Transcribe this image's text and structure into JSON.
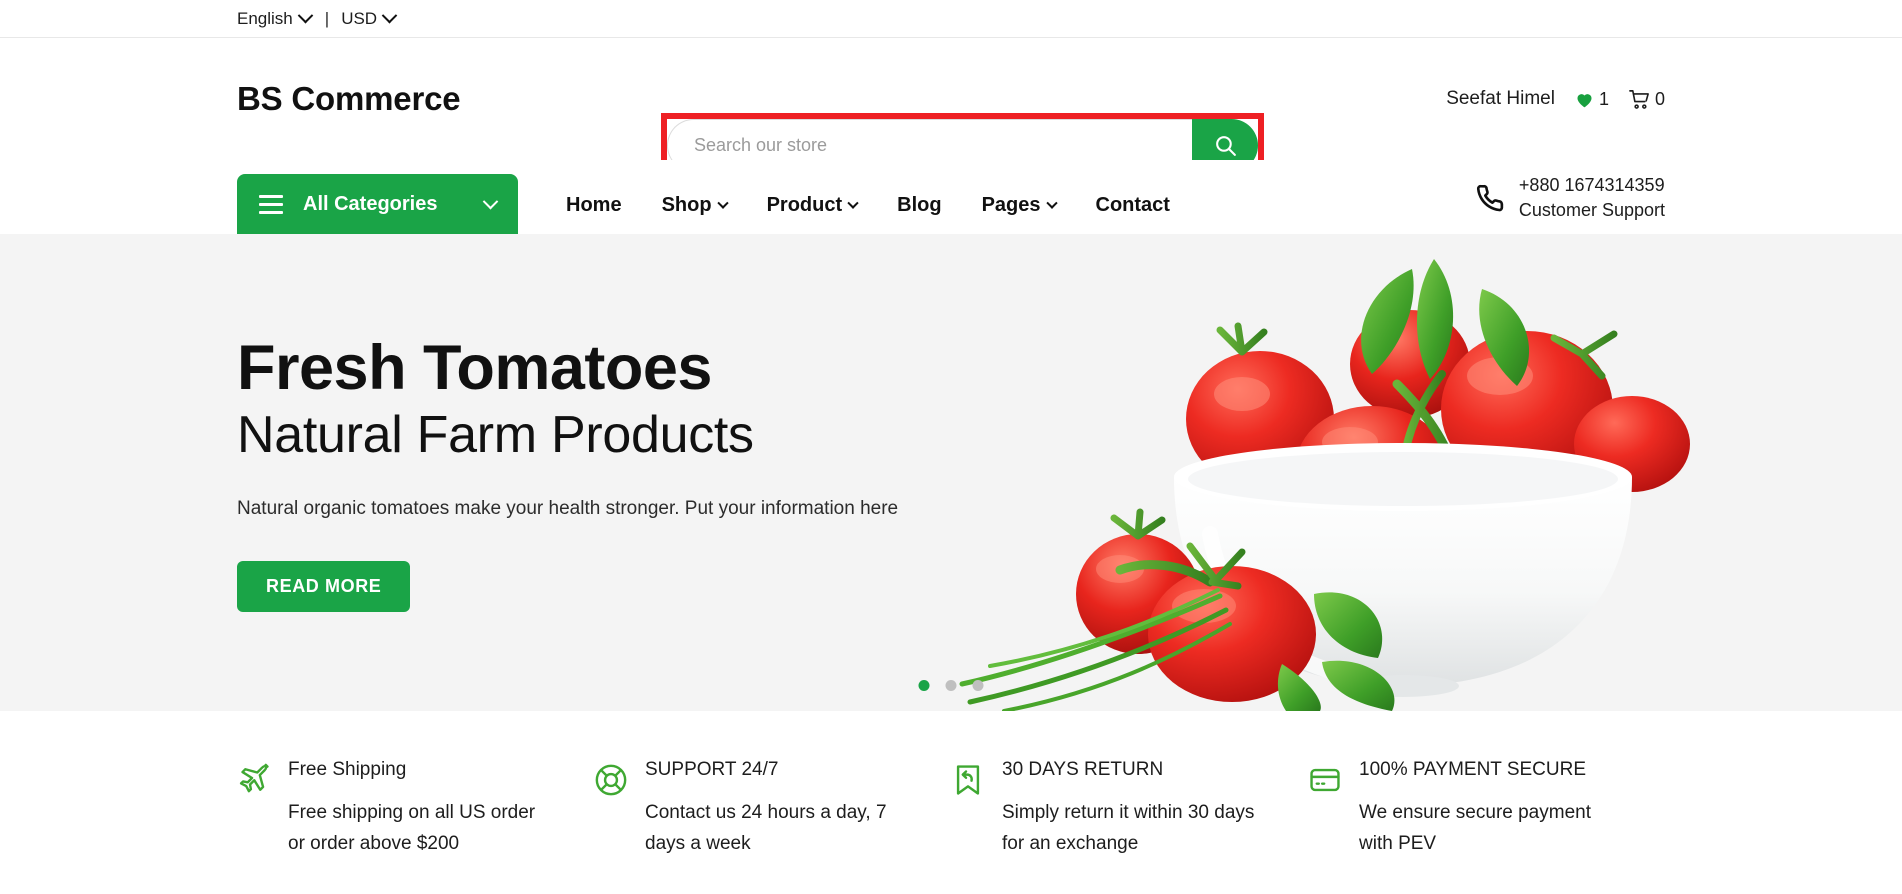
{
  "topbar": {
    "language": "English",
    "separator": "|",
    "currency": "USD"
  },
  "header": {
    "brand": "BS Commerce",
    "search": {
      "placeholder": "Search our store",
      "value": "",
      "icon": "search-icon",
      "highlight_color": "#ee2024"
    },
    "account": {
      "user_name": "Seefat Himel",
      "wishlist_icon": "heart-icon",
      "wishlist_count": "1",
      "cart_icon": "cart-icon",
      "cart_count": "0"
    }
  },
  "nav": {
    "all_categories": {
      "label": "All Categories",
      "menu_icon": "hamburger-icon",
      "chevron_icon": "chevron-down-icon"
    },
    "items": [
      {
        "label": "Home",
        "has_dropdown": false
      },
      {
        "label": "Shop",
        "has_dropdown": true
      },
      {
        "label": "Product",
        "has_dropdown": true
      },
      {
        "label": "Blog",
        "has_dropdown": false
      },
      {
        "label": "Pages",
        "has_dropdown": true
      },
      {
        "label": "Contact",
        "has_dropdown": false
      }
    ],
    "support": {
      "icon": "phone-icon",
      "phone": "+880 1674314359",
      "label": "Customer Support"
    }
  },
  "hero": {
    "title": "Fresh Tomatoes",
    "subtitle": "Natural Farm Products",
    "description": "Natural organic tomatoes make your health stronger. Put your information here",
    "button_label": "READ MORE",
    "image_alt": "bowl-of-tomatoes-image",
    "carousel": {
      "total": 3,
      "active_index": 0
    },
    "background_color": "#f4f4f4"
  },
  "features": [
    {
      "icon": "airplane-icon",
      "title": "Free Shipping",
      "description": "Free shipping on all US order or order above $200"
    },
    {
      "icon": "lifebuoy-icon",
      "title": "SUPPORT 24/7",
      "description": "Contact us 24 hours a day, 7 days a week"
    },
    {
      "icon": "return-arrow-icon",
      "title": "30 DAYS RETURN",
      "description": "Simply return it within 30 days for an exchange"
    },
    {
      "icon": "credit-card-icon",
      "title": "100% PAYMENT SECURE",
      "description": "We ensure secure payment with PEV"
    }
  ],
  "theme": {
    "accent_green": "#1aa447",
    "highlight_red": "#ee2024"
  }
}
